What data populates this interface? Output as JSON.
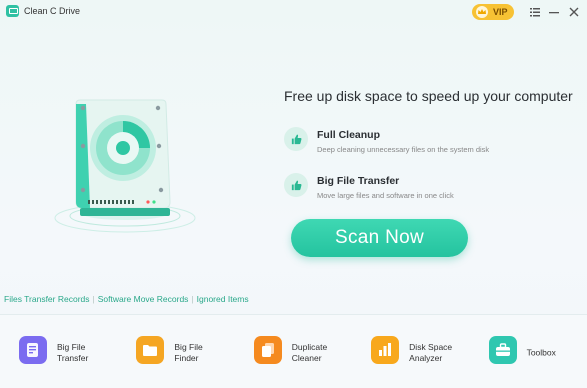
{
  "app": {
    "title": "Clean C Drive",
    "vip_label": "VIP"
  },
  "window_controls": {
    "menu_icon": "menu-icon",
    "minimize_icon": "minimize-icon",
    "close_icon": "close-icon"
  },
  "main": {
    "headline": "Free up disk space to speed up your computer",
    "features": [
      {
        "title": "Full Cleanup",
        "desc": "Deep cleaning unnecessary files on the system disk",
        "icon": "thumbs-up-icon"
      },
      {
        "title": "Big File Transfer",
        "desc": "Move large files and software in one click",
        "icon": "thumbs-up-icon"
      }
    ],
    "scan_label": "Scan Now"
  },
  "links": [
    "Files Transfer Records",
    "Software Move Records",
    "Ignored Items"
  ],
  "tools": [
    {
      "label": "Big File\nTransfer",
      "icon": "file-transfer-icon",
      "color": "#7b6cf0"
    },
    {
      "label": "Big File\nFinder",
      "icon": "folder-icon",
      "color": "#f5a623"
    },
    {
      "label": "Duplicate\nCleaner",
      "icon": "duplicate-icon",
      "color": "#f58a1f"
    },
    {
      "label": "Disk Space\nAnalyzer",
      "icon": "chart-icon",
      "color": "#f8a81c"
    },
    {
      "label": "Toolbox",
      "icon": "toolbox-icon",
      "color": "#2fc7b0"
    }
  ],
  "colors": {
    "accent": "#2fc1a3",
    "vip": "#f7c234",
    "link": "#2aa88a"
  }
}
